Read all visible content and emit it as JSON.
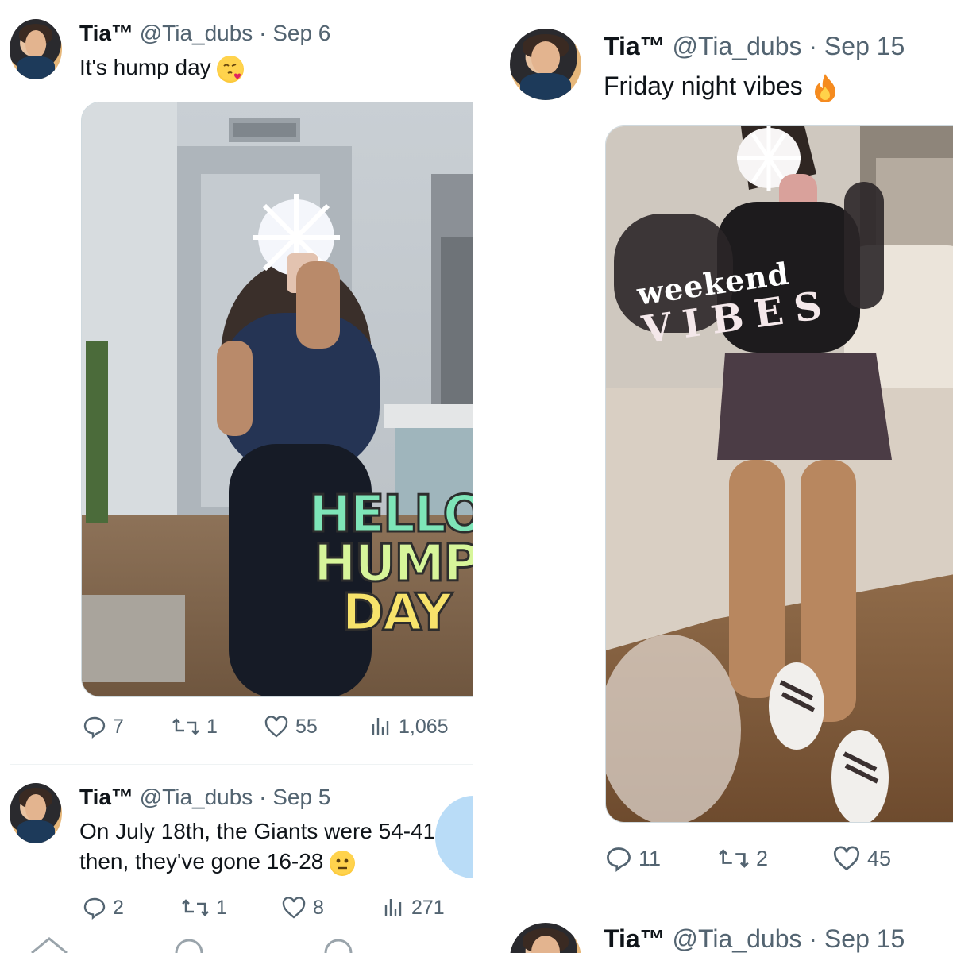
{
  "left": {
    "tweet1": {
      "name": "Tia™",
      "handle": "@Tia_dubs",
      "dot": "·",
      "date": "Sep 6",
      "text": "It's hump day",
      "emoji_icon": "face-blowing-kiss-icon",
      "media_overlay": [
        "HELLO",
        "HUMP",
        "DAY"
      ],
      "stats": {
        "replies": "7",
        "reposts": "1",
        "likes": "55",
        "views": "1,065"
      }
    },
    "tweet2": {
      "name": "Tia™",
      "handle": "@Tia_dubs",
      "dot": "·",
      "date": "Sep 5",
      "line1": "On July 18th, the Giants were 54-41. Si",
      "line2": "then, they've gone 16-28",
      "emoji_icon": "neutral-face-icon",
      "stats": {
        "replies": "2",
        "reposts": "1",
        "likes": "8",
        "views": "271"
      }
    }
  },
  "right": {
    "tweet1": {
      "name": "Tia™",
      "handle": "@Tia_dubs",
      "dot": "·",
      "date": "Sep 15",
      "text": "Friday night vibes",
      "emoji_icon": "fire-icon",
      "media_overlay": {
        "line1": "weekend",
        "line2": "VIBES"
      },
      "stats": {
        "replies": "11",
        "reposts": "2",
        "likes": "45"
      }
    },
    "tweet2_partial": {
      "name": "Tia™",
      "handle": "@Tia_dubs",
      "dot": "·",
      "date": "Sep 15"
    }
  },
  "colors": {
    "secondary_text": "#536471",
    "primary_text": "#0f1419",
    "fab_blue": "#b9dcf7"
  }
}
